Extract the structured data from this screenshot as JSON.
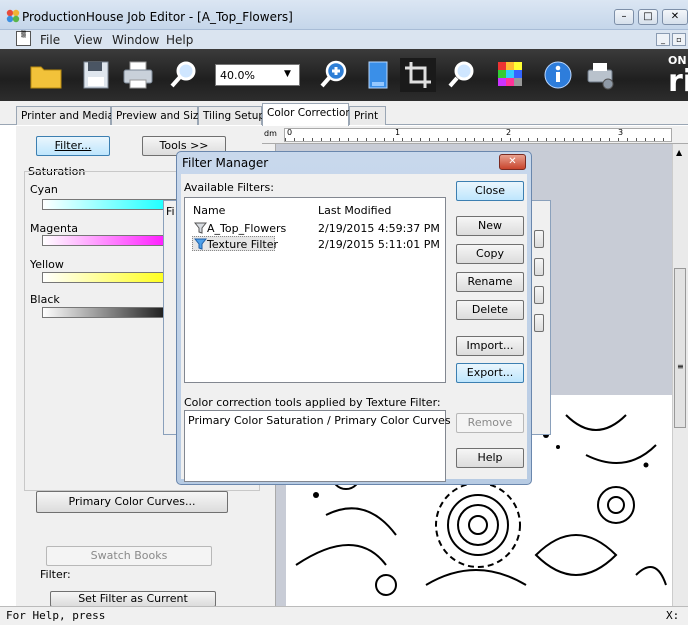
{
  "window": {
    "title": "ProductionHouse Job Editor - [A_Top_Flowers]",
    "minimize": "–",
    "maximize": "□",
    "close": "✕"
  },
  "menu": [
    "File",
    "View",
    "Window",
    "Help"
  ],
  "mdi": {
    "min": "_",
    "restore": "ð",
    "close": "✕"
  },
  "toolbar": {
    "zoom": "40.0%",
    "brand_top": "ON",
    "brand_big": "ri"
  },
  "tabs": [
    "Printer and Media",
    "Preview and Size",
    "Tiling Setup",
    "Color Correction",
    "Print"
  ],
  "left": {
    "filter_button": "Filter...",
    "tools_button": "Tools >>",
    "saturation": "Saturation",
    "cyan": "Cyan",
    "magenta": "Magenta",
    "yellow": "Yellow",
    "black": "Black",
    "curves_button": "Primary Color Curves...",
    "swatch_button": "Swatch Books",
    "filter_group": "Filter:",
    "set_filter_button": "Set Filter as Current"
  },
  "ruler": {
    "unit": "dm",
    "marks": [
      "0",
      "1",
      "2",
      "3"
    ]
  },
  "dialog": {
    "title": "Filter Manager",
    "available": "Available Filters:",
    "col_name": "Name",
    "col_modified": "Last Modified",
    "filters": [
      {
        "name": "A_Top_Flowers",
        "modified": "2/19/2015 4:59:37 PM"
      },
      {
        "name": "Texture Filter",
        "modified": "2/19/2015 5:11:01 PM"
      }
    ],
    "applied_label": "Color correction tools applied by Texture Filter:",
    "applied_text": "Primary Color Saturation / Primary Color Curves",
    "buttons": {
      "close": "Close",
      "new": "New",
      "copy": "Copy",
      "rename": "Rename",
      "delete": "Delete",
      "import": "Import...",
      "export": "Export...",
      "remove": "Remove",
      "help": "Help"
    }
  },
  "bg_dialog": {
    "title_fragment": "Fi"
  },
  "status": {
    "left": "For Help, press",
    "right": "X:"
  },
  "colors": {
    "toolbar_bg": "#2a2a2a",
    "dialog_frame": "#b7cbe3",
    "cyan": "#00ffff",
    "magenta": "#ff00ff",
    "yellow": "#ffff00"
  }
}
